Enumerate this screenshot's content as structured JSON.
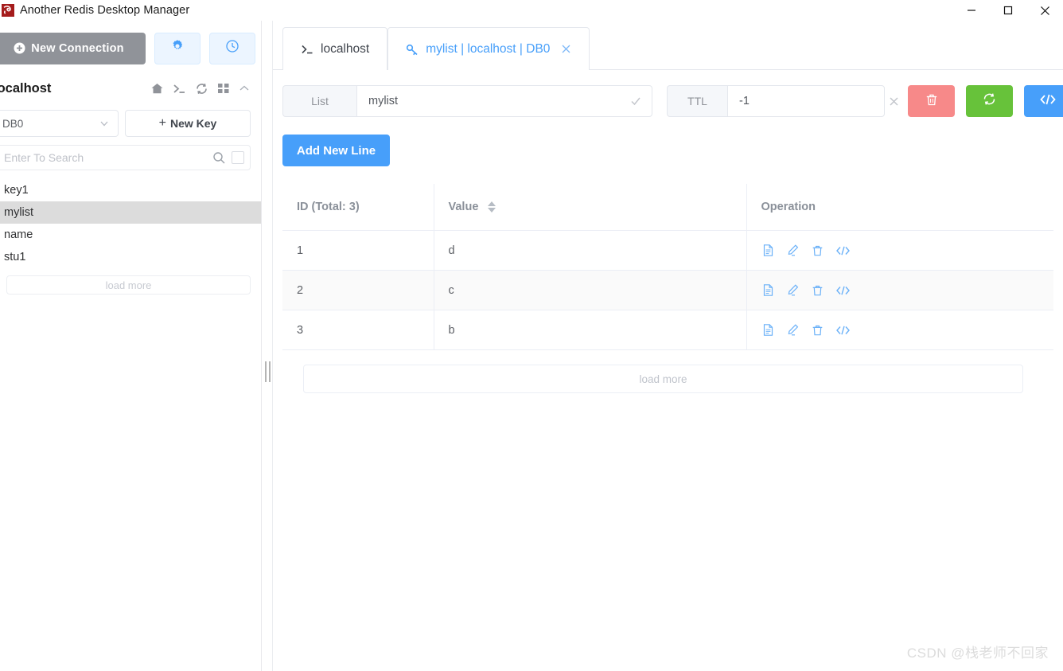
{
  "window": {
    "title": "Another Redis Desktop Manager",
    "logo_icon": "redis-logo-icon",
    "minimize_icon": "minimize-icon",
    "maximize_icon": "maximize-icon",
    "close_icon": "close-icon",
    "accent_color": "#479ffa"
  },
  "sidebar": {
    "new_connection_label": "New Connection",
    "new_connection_icon": "plus-circle-icon",
    "settings_icon": "gear-icon",
    "history_icon": "clock-icon",
    "connection_name": "localhost",
    "header_icons": [
      "home-icon",
      "terminal-icon",
      "refresh-icon",
      "grid-icon",
      "chevron-up-icon"
    ],
    "db_selected": "DB0",
    "db_chevron_icon": "chevron-down-icon",
    "new_key_label": "New Key",
    "new_key_plus": "+",
    "search_placeholder": "Enter To Search",
    "search_value": "",
    "search_icon": "search-icon",
    "search_toggle_icon": "checkbox-icon",
    "keys": [
      {
        "name": "key1",
        "selected": false
      },
      {
        "name": "mylist",
        "selected": true
      },
      {
        "name": "name",
        "selected": false
      },
      {
        "name": "stu1",
        "selected": false
      }
    ],
    "load_more_label": "load more",
    "splitter_icon": "drag-handle-icon"
  },
  "tabs": [
    {
      "label": "localhost",
      "prefix_icon": "terminal-icon",
      "active": false,
      "closable": false
    },
    {
      "label": "mylist | localhost | DB0",
      "prefix_icon": "key-icon",
      "active": true,
      "closable": true,
      "close_icon": "close-icon"
    }
  ],
  "key_header": {
    "type_label": "List",
    "key_name_value": "mylist",
    "key_name_confirm_icon": "check-icon",
    "ttl_label": "TTL",
    "ttl_value": "-1",
    "ttl_clear_icon": "close-icon",
    "ttl_confirm_icon": "check-icon",
    "actions": [
      {
        "name": "delete-key-button",
        "icon": "trash-icon",
        "color": "#f78989"
      },
      {
        "name": "refresh-key-button",
        "icon": "refresh-icon",
        "color": "#67c23a"
      },
      {
        "name": "code-view-button",
        "icon": "code-icon",
        "color": "#479ffa"
      }
    ]
  },
  "content": {
    "add_new_line_label": "Add New Line",
    "table": {
      "columns": [
        "ID (Total: 3)",
        "Value",
        "Operation"
      ],
      "value_sort_icon": "sort-arrows-icon",
      "rows": [
        {
          "id": "1",
          "value": "d"
        },
        {
          "id": "2",
          "value": "c"
        },
        {
          "id": "3",
          "value": "b"
        }
      ],
      "row_ops": [
        "detail-icon",
        "edit-icon",
        "delete-icon",
        "code-icon"
      ]
    },
    "load_more_label": "load more"
  },
  "watermark": "CSDN @栈老师不回家"
}
